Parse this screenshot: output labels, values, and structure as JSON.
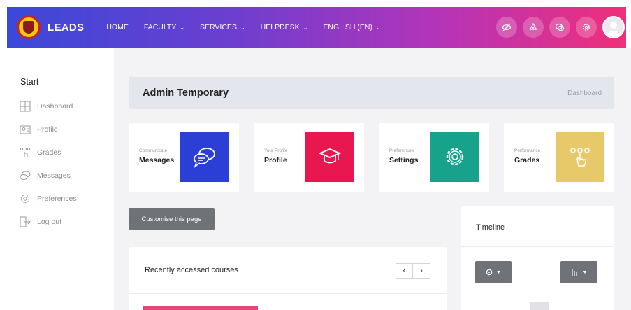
{
  "brand": {
    "name": "LEADS"
  },
  "nav": {
    "home": "HOME",
    "faculty": "FACULTY",
    "services": "SERVICES",
    "helpdesk": "HELPDESK",
    "language": "ENGLISH (EN)"
  },
  "nav_icons": [
    "eye-slash-icon",
    "recycle-icon",
    "chat-icon",
    "gear-icon"
  ],
  "sidebar": {
    "title": "Start",
    "items": [
      {
        "label": "Dashboard",
        "icon": "dashboard-icon"
      },
      {
        "label": "Profile",
        "icon": "profile-icon"
      },
      {
        "label": "Grades",
        "icon": "grades-icon"
      },
      {
        "label": "Messages",
        "icon": "messages-icon"
      },
      {
        "label": "Preferences",
        "icon": "preferences-icon"
      },
      {
        "label": "Log out",
        "icon": "logout-icon"
      }
    ]
  },
  "header": {
    "title": "Admin Temporary",
    "breadcrumb": "Dashboard"
  },
  "cards": [
    {
      "caption": "Communicate",
      "name": "Messages",
      "color": "#2b3ed6",
      "icon": "chat-bubbles-icon"
    },
    {
      "caption": "Your Profile",
      "name": "Profile",
      "color": "#e8174f",
      "icon": "graduation-cap-icon"
    },
    {
      "caption": "Preferences",
      "name": "Settings",
      "color": "#17a38b",
      "icon": "gear-icon"
    },
    {
      "caption": "Performance",
      "name": "Grades",
      "color": "#e8c96a",
      "icon": "rating-hand-icon"
    }
  ],
  "customise_button": "Customise this page",
  "recent": {
    "title": "Recently accessed courses",
    "prev": "‹",
    "next": "›"
  },
  "timeline": {
    "title": "Timeline"
  },
  "colors": {
    "nav_gradient_start": "#3b48d8",
    "nav_gradient_end": "#ef2f7a",
    "button_gray": "#6f7378"
  }
}
